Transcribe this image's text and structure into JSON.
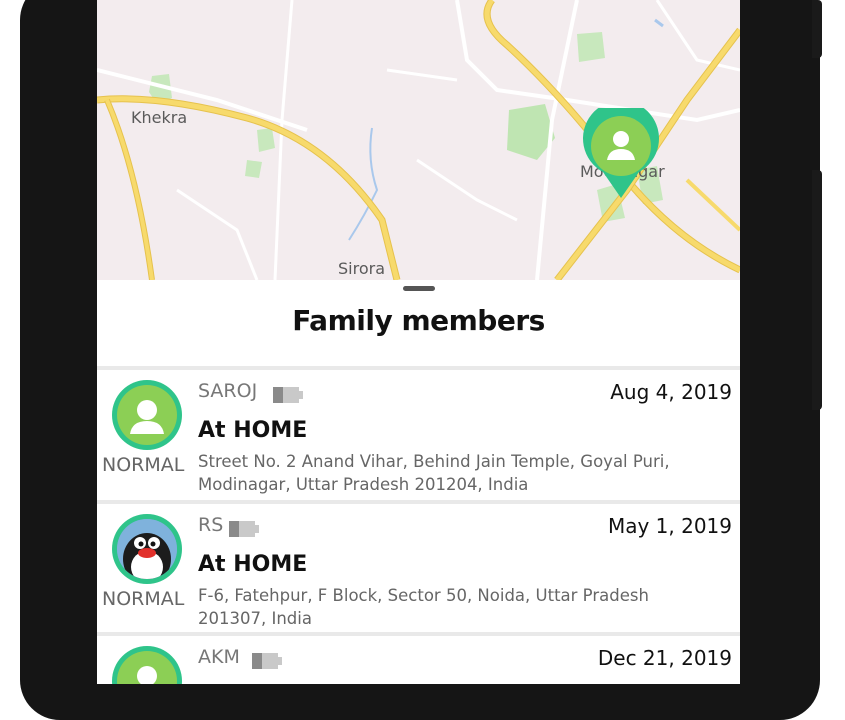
{
  "map": {
    "places": [
      "Khekra",
      "Modinagar",
      "Sirora"
    ],
    "marker_icon": "person-pin-icon",
    "colors": {
      "background": "#f3ecee",
      "road": "#f5d25f",
      "park": "#bfe5b2",
      "water": "#a9c8ec",
      "marker": "#2fc48a"
    }
  },
  "sheet": {
    "title": "Family members"
  },
  "members": [
    {
      "name": "SAROJ",
      "date": "Aug 4, 2019",
      "place": "At HOME",
      "address": "Street No. 2 Anand Vihar, Behind Jain Temple, Goyal Puri, Modinagar, Uttar Pradesh 201204, India",
      "status": "NORMAL",
      "avatar": "person-icon",
      "battery_icon": "battery-icon"
    },
    {
      "name": "RS",
      "date": "May 1, 2019",
      "place": "At HOME",
      "address": "F-6, Fatehpur, F Block, Sector 50, Noida, Uttar Pradesh 201307, India",
      "status": "NORMAL",
      "avatar": "penguin-avatar-icon",
      "battery_icon": "battery-icon"
    },
    {
      "name": "AKM",
      "date": "Dec 21, 2019",
      "avatar": "person-icon",
      "battery_icon": "battery-icon"
    }
  ]
}
